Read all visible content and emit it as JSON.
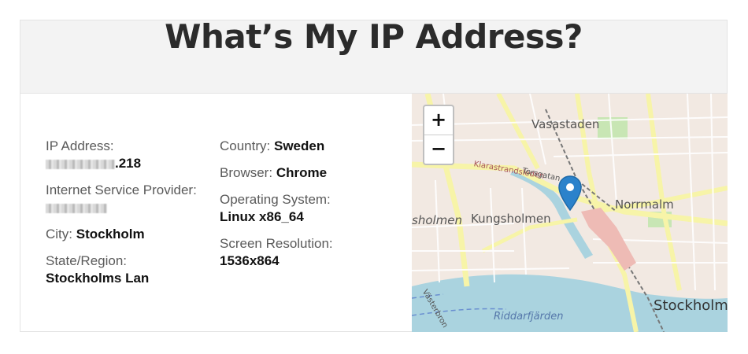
{
  "header": {
    "title": "What’s My IP Address?"
  },
  "left_column": {
    "ip_label": "IP Address:",
    "ip_suffix": ".218",
    "isp_label": "Internet Service Provider:",
    "city_label": "City:",
    "city_value": "Stockholm",
    "state_label": "State/Region:",
    "state_value": "Stockholms Lan"
  },
  "right_column": {
    "country_label": "Country:",
    "country_value": "Sweden",
    "browser_label": "Browser:",
    "browser_value": "Chrome",
    "os_label": "Operating System:",
    "os_value": "Linux x86_64",
    "resolution_label": "Screen Resolution:",
    "resolution_value": "1536x864"
  },
  "map": {
    "zoom_in": "+",
    "zoom_out": "−",
    "labels": {
      "vasastaden": "Vasastaden",
      "kungsholmen": "Kungsholmen",
      "kungsholmen_cut": "sholmen",
      "norrmalm": "Norrmalm",
      "stockholm": "Stockholm",
      "riddarfjarden": "Riddarfjärden",
      "klarastrandsleden": "Klarastrandsleden",
      "torsgatan": "Torsgatan",
      "vasterbron": "Västerbron"
    },
    "colors": {
      "water": "#aad3df",
      "land": "#f2e9e2",
      "road": "#f7f4a8",
      "park": "#c8e6b4",
      "marker": "#2b82cb"
    }
  }
}
